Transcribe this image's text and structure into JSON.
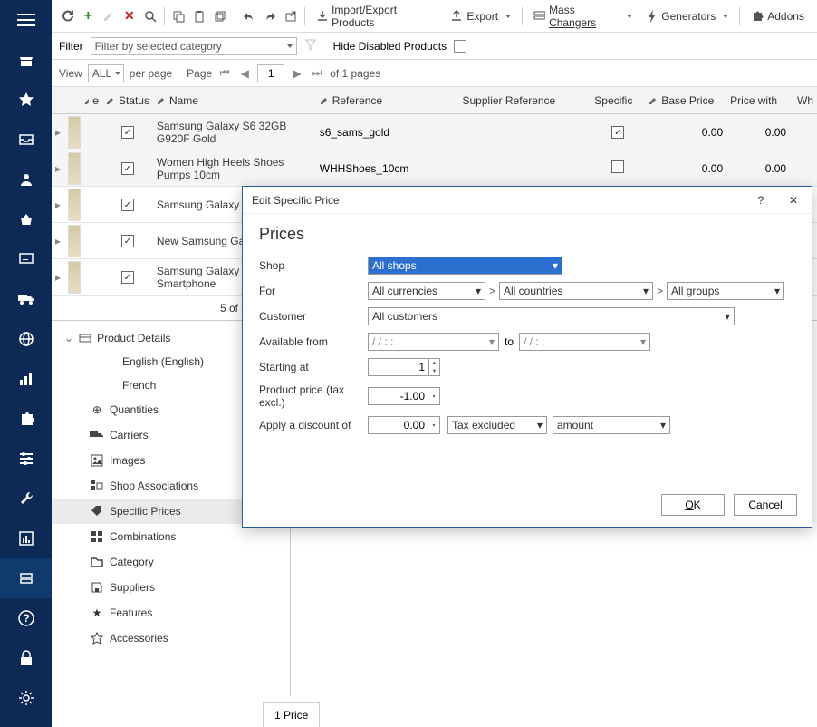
{
  "toolbar": {
    "import_export": "Import/Export Products",
    "export": "Export",
    "mass_changers": "Mass Changers",
    "generators": "Generators",
    "addons": "Addons"
  },
  "filter": {
    "label": "Filter",
    "dropdown": "Filter by selected category",
    "hide_disabled": "Hide Disabled Products"
  },
  "pager": {
    "view": "View",
    "all": "ALL",
    "per_page": "per page",
    "page": "Page",
    "current": "1",
    "of_pages": "of 1 pages"
  },
  "columns": {
    "e": "e",
    "status": "Status",
    "name": "Name",
    "reference": "Reference",
    "supplier_reference": "Supplier Reference",
    "specific": "Specific",
    "base_price": "Base Price",
    "price_with": "Price with",
    "wh": "Wh"
  },
  "rows": [
    {
      "name": "Samsung Galaxy S6 32GB G920F Gold",
      "ref": "s6_sams_gold",
      "specific": true,
      "base": "0.00",
      "price": "0.00"
    },
    {
      "name": "Women High Heels Shoes Pumps 10cm",
      "ref": "WHHShoes_10cm",
      "specific": false,
      "base": "0.00",
      "price": "0.00"
    },
    {
      "name": "Samsung Galaxy S Gold",
      "ref": "",
      "specific": true,
      "base": "",
      "price": ""
    },
    {
      "name": "New Samsung Ga G920F Gold",
      "ref": "",
      "specific": true,
      "base": "",
      "price": ""
    },
    {
      "name": "Samsung Galaxy S 32GB Smartphone",
      "ref": "",
      "specific": true,
      "base": "",
      "price": ""
    }
  ],
  "footer_count": "5 of 5 Product(s)",
  "tree": {
    "product_details": "Product Details",
    "lang_en": "English (English)",
    "lang_fr": "French",
    "quantities": "Quantities",
    "carriers": "Carriers",
    "images": "Images",
    "shop_assoc": "Shop Associations",
    "specific_prices": "Specific Prices",
    "combinations": "Combinations",
    "category": "Category",
    "suppliers": "Suppliers",
    "features": "Features",
    "accessories": "Accessories"
  },
  "bottom_tab": "1 Price",
  "dialog": {
    "title": "Edit Specific Price",
    "heading": "Prices",
    "shop_label": "Shop",
    "shop_value": "All shops",
    "for_label": "For",
    "currencies": "All currencies",
    "countries": "All countries",
    "groups": "All groups",
    "customer_label": "Customer",
    "customer_value": "All customers",
    "avail_label": "Available from",
    "date_placeholder": "/  /       :   :",
    "to": "to",
    "starting_label": "Starting at",
    "starting_value": "1",
    "prodprice_label": "Product price (tax excl.)",
    "prodprice_value": "-1.00",
    "discount_label": "Apply a discount of",
    "discount_value": "0.00",
    "tax_mode": "Tax excluded",
    "amount_mode": "amount",
    "ok": "OK",
    "cancel": "Cancel"
  }
}
